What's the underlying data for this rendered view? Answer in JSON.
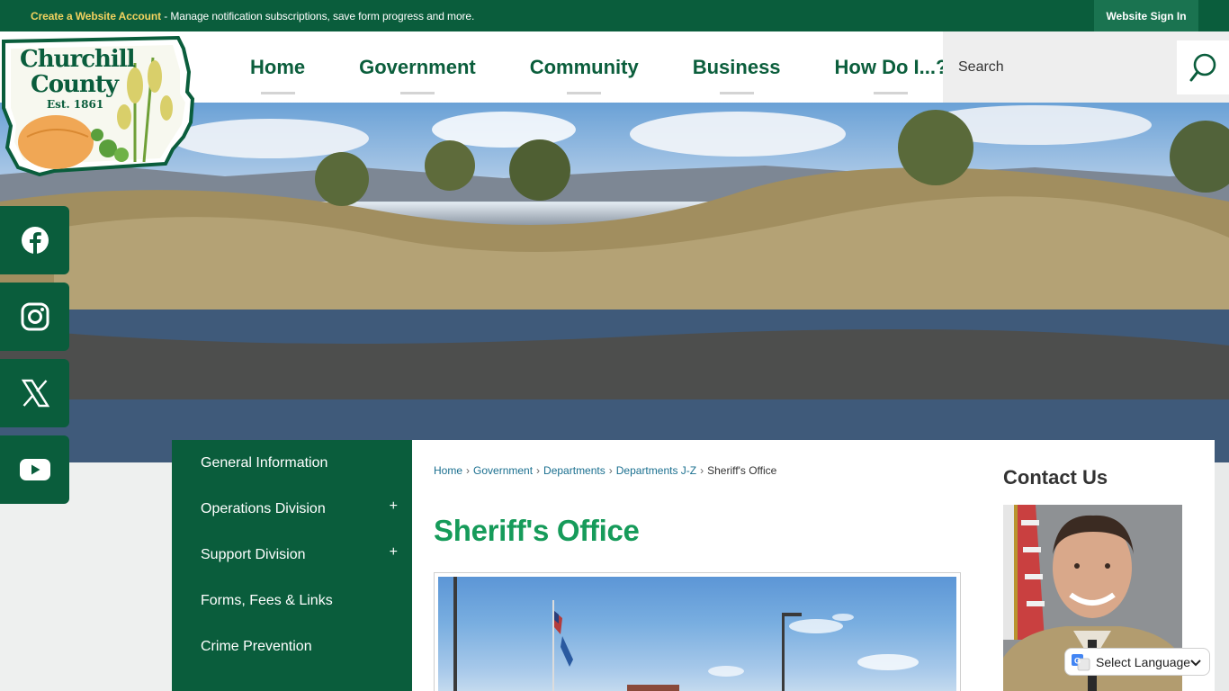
{
  "topbar": {
    "create_link": "Create a Website Account",
    "message": " - Manage notification subscriptions, save form progress and more.",
    "signin": "Website Sign In"
  },
  "logo": {
    "line1": "Churchill",
    "line2": "County",
    "line3": "Est. 1861"
  },
  "nav": {
    "items": [
      {
        "label": "Home"
      },
      {
        "label": "Government"
      },
      {
        "label": "Community"
      },
      {
        "label": "Business"
      },
      {
        "label": "How Do I...?"
      }
    ]
  },
  "search": {
    "placeholder": "Search"
  },
  "social": {
    "icons": [
      "facebook-icon",
      "instagram-icon",
      "x-icon",
      "youtube-icon"
    ]
  },
  "sidenav": {
    "items": [
      {
        "label": "General Information",
        "expandable": false
      },
      {
        "label": "Operations Division",
        "expandable": true
      },
      {
        "label": "Support Division",
        "expandable": true
      },
      {
        "label": "Forms, Fees & Links",
        "expandable": false
      },
      {
        "label": "Crime Prevention",
        "expandable": false
      }
    ],
    "expand_symbol": "+"
  },
  "breadcrumb": {
    "items": [
      "Home",
      "Government",
      "Departments",
      "Departments J-Z"
    ],
    "current": "Sheriff's Office",
    "separator": "›"
  },
  "page": {
    "title": "Sheriff's Office"
  },
  "sidebar_right": {
    "contact_title": "Contact Us"
  },
  "translate": {
    "label": "Select Language"
  },
  "colors": {
    "brand_green": "#0a5d3c",
    "title_green": "#169b5a",
    "accent_yellow": "#f2d25f",
    "link_blue": "#1a6f8f"
  }
}
